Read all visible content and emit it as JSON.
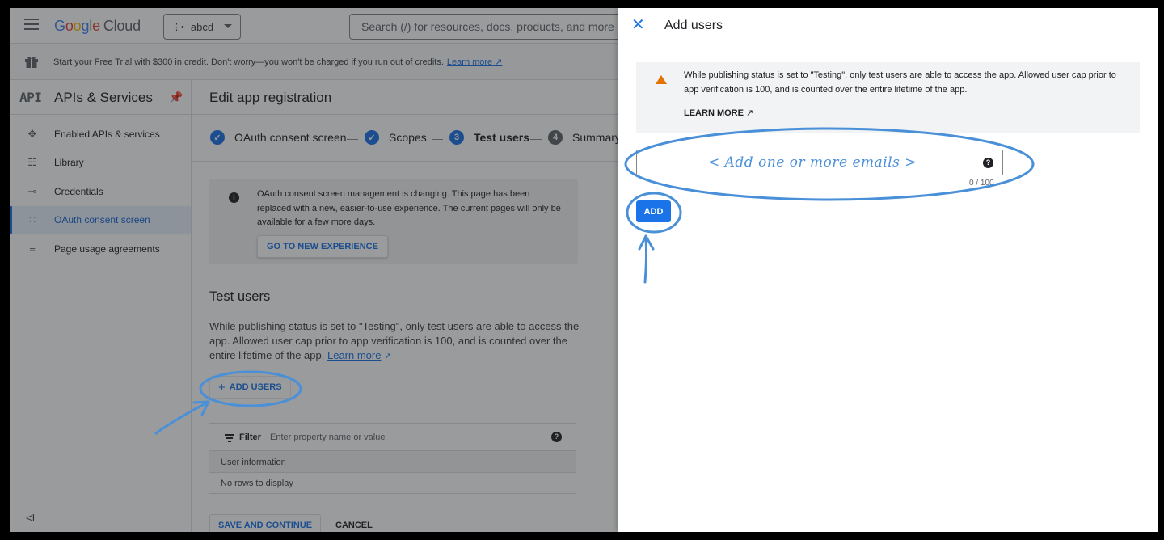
{
  "topbar": {
    "logo_g": "G",
    "logo_o1": "o",
    "logo_o2": "o",
    "logo_g2": "g",
    "logo_l": "l",
    "logo_e": "e",
    "logo_cloud": "Cloud",
    "project_name": "abcd",
    "search_placeholder": "Search (/) for resources, docs, products, and more"
  },
  "trial": {
    "text": "Start your Free Trial with $300 in credit. Don't worry—you won't be charged if you run out of credits.",
    "link": "Learn more"
  },
  "sidebar": {
    "logo": "API",
    "title": "APIs & Services",
    "items": [
      {
        "label": "Enabled APIs & services",
        "icon": "enabled-apis-icon"
      },
      {
        "label": "Library",
        "icon": "library-icon"
      },
      {
        "label": "Credentials",
        "icon": "key-icon"
      },
      {
        "label": "OAuth consent screen",
        "icon": "oauth-icon",
        "active": true
      },
      {
        "label": "Page usage agreements",
        "icon": "settings-list-icon"
      }
    ],
    "collapse": "<I"
  },
  "main": {
    "title": "Edit app registration",
    "steps": [
      {
        "label": "OAuth consent screen",
        "state": "done"
      },
      {
        "label": "Scopes",
        "state": "done"
      },
      {
        "number": "3",
        "label": "Test users",
        "state": "current"
      },
      {
        "number": "4",
        "label": "Summary",
        "state": "next"
      }
    ],
    "notice": {
      "text": "OAuth consent screen management is changing. This page has been replaced with a new, easier-to-use experience. The current pages will only be available for a few more days.",
      "button": "GO TO NEW EXPERIENCE"
    },
    "test_users": {
      "title": "Test users",
      "description": "While publishing status is set to \"Testing\", only test users are able to access the app. Allowed user cap prior to app verification is 100, and is counted over the entire lifetime of the app.",
      "learn_more": "Learn more",
      "add_button": "ADD USERS"
    },
    "table": {
      "filter_label": "Filter",
      "filter_placeholder": "Enter property name or value",
      "column_header": "User information",
      "empty": "No rows to display"
    },
    "save_button": "SAVE AND CONTINUE",
    "cancel_button": "CANCEL"
  },
  "drawer": {
    "title": "Add users",
    "warning": "While publishing status is set to \"Testing\", only test users are able to access the app. Allowed user cap prior to app verification is 100, and is counted over the entire lifetime of the app.",
    "learn_more": "LEARN MORE",
    "email_placeholder": "< Add one or more emails >",
    "count": "0 / 100",
    "add_button": "ADD"
  },
  "colors": {
    "accent": "#1a73e8",
    "warning": "#e37400",
    "annotation": "#4a90d9"
  }
}
